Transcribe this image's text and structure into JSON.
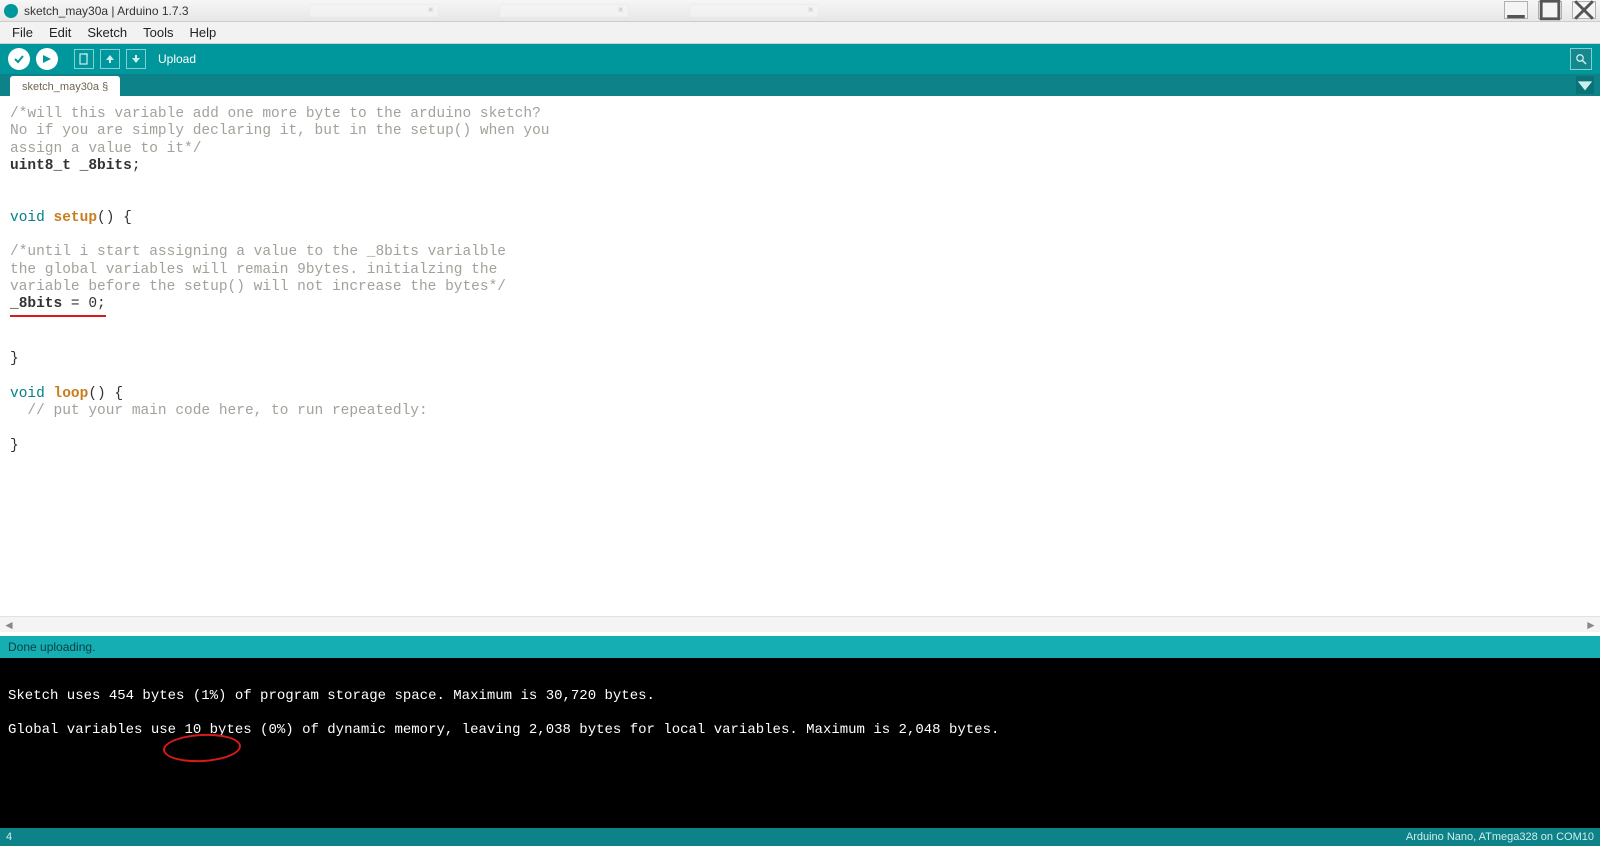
{
  "window": {
    "title": "sketch_may30a | Arduino 1.7.3"
  },
  "menu": {
    "items": [
      "File",
      "Edit",
      "Sketch",
      "Tools",
      "Help"
    ]
  },
  "toolbar": {
    "upload_label": "Upload",
    "buttons": {
      "verify": "verify",
      "upload": "upload",
      "new": "new",
      "open": "open",
      "save": "save",
      "serial": "serial-monitor"
    }
  },
  "tab": {
    "name": "sketch_may30a §"
  },
  "code": {
    "comment_top_l1": "/*will this variable add one more byte to the arduino sketch?",
    "comment_top_l2": "No if you are simply declaring it, but in the setup() when you",
    "comment_top_l3": "assign a value to it*/",
    "decl_type": "uint8_t",
    "decl_name": "_8bits",
    "semicolon": ";",
    "void1": "void",
    "setup_fn": "setup",
    "parens_brace_open": "() {",
    "comment_mid_l1": "/*until i start assigning a value to the _8bits varialble",
    "comment_mid_l2": "the global variables will remain 9bytes. initialzing the",
    "comment_mid_l3": "variable before the setup() will not increase the bytes*/",
    "assign_lhs": "_8bits",
    "assign_eq": " = ",
    "assign_rhs": "0",
    "assign_semi": ";",
    "brace_close1": "}",
    "void2": "void",
    "loop_fn": "loop",
    "comment_loop": "  // put your main code here, to run repeatedly:",
    "brace_close2": "}"
  },
  "status": {
    "text": "Done uploading."
  },
  "console": {
    "line1_a": "Sketch uses 454 bytes (1%) of program storage space. Maximum is 30,720 bytes.",
    "line2_a": "Global variables use ",
    "line2_highlight": "10 bytes",
    "line2_b": " (0%) of dynamic memory, leaving 2,038 bytes for local variables. Maximum is 2,048 bytes."
  },
  "footer": {
    "left": "4",
    "right": "Arduino Nano, ATmega328 on COM10"
  }
}
